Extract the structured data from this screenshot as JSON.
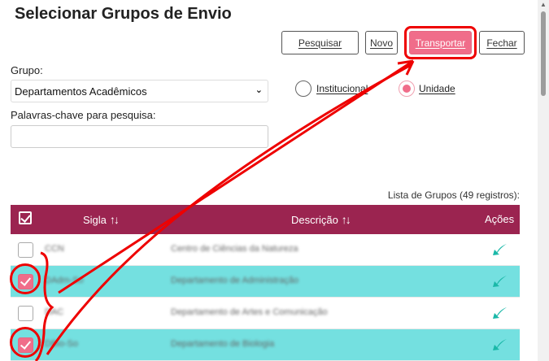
{
  "page": {
    "title": "Selecionar Grupos de Envio"
  },
  "toolbar": {
    "pesquisar_label": "Pesquisar",
    "novo_label": "Novo",
    "transportar_label": "Transportar",
    "fechar_label": "Fechar"
  },
  "form": {
    "grupo_label": "Grupo:",
    "grupo_selected": "Departamentos Acadêmicos",
    "palavras_label": "Palavras-chave para pesquisa:",
    "palavras_value": "",
    "radio_institucional": "Institucional",
    "radio_unidade": "Unidade",
    "radio_selected": "Unidade"
  },
  "list": {
    "count_label": "Lista de Grupos (49 registros):",
    "columns": {
      "sigla": "Sigla",
      "descricao": "Descrição",
      "acoes": "Ações"
    },
    "rows": [
      {
        "sigla": "CCN",
        "descricao": "Centro de Ciências da Natureza",
        "checked": false
      },
      {
        "sigla": "DAdm-So",
        "descricao": "Departamento de Administração",
        "checked": true
      },
      {
        "sigla": "DAC",
        "descricao": "Departamento de Artes e Comunicação",
        "checked": false
      },
      {
        "sigla": "DBio-So",
        "descricao": "Departamento de Biologia",
        "checked": true
      }
    ]
  },
  "colors": {
    "header_bg": "#9b2450",
    "selected_row_bg": "#74e0e0",
    "accent_pink": "#f06d8a",
    "action_icon": "#1ab8a8",
    "annotation_red": "#e00000"
  },
  "icons": {
    "sort": "sort-arrows-icon",
    "action": "transport-arrow-icon",
    "select_all": "check-all-icon"
  }
}
